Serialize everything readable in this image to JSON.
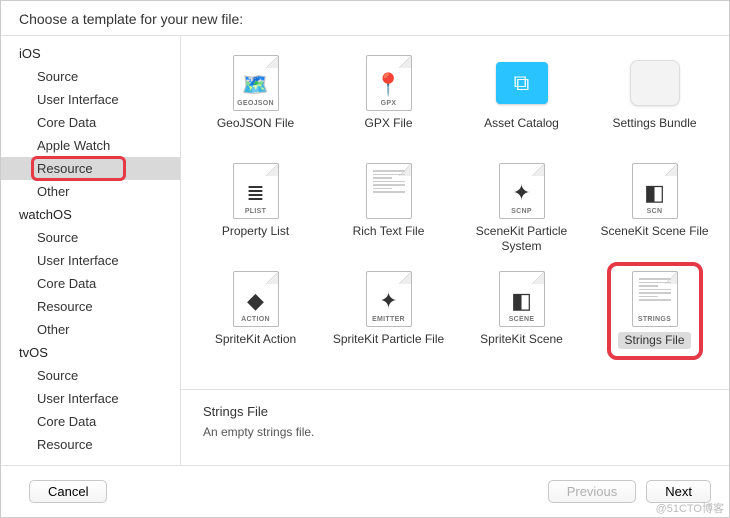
{
  "header": {
    "title": "Choose a template for your new file:"
  },
  "sidebar": {
    "platforms": [
      {
        "name": "iOS",
        "categories": [
          "Source",
          "User Interface",
          "Core Data",
          "Apple Watch",
          "Resource",
          "Other"
        ],
        "selected": "Resource"
      },
      {
        "name": "watchOS",
        "categories": [
          "Source",
          "User Interface",
          "Core Data",
          "Resource",
          "Other"
        ]
      },
      {
        "name": "tvOS",
        "categories": [
          "Source",
          "User Interface",
          "Core Data",
          "Resource"
        ]
      }
    ]
  },
  "templates": {
    "rows": [
      [
        {
          "label": "GeoJSON File",
          "tag": "GEOJSON",
          "glyph": "🗺️"
        },
        {
          "label": "GPX File",
          "tag": "GPX",
          "glyph": "📍"
        },
        {
          "label": "Asset Catalog",
          "type": "asset"
        },
        {
          "label": "Settings Bundle",
          "type": "bundle"
        }
      ],
      [
        {
          "label": "Property List",
          "tag": "PLIST",
          "glyph": "≣"
        },
        {
          "label": "Rich Text File",
          "tag": "",
          "glyph": "",
          "rtf": true
        },
        {
          "label": "SceneKit Particle System",
          "tag": "SCNP",
          "glyph": "✦"
        },
        {
          "label": "SceneKit Scene File",
          "tag": "SCN",
          "glyph": "◧"
        }
      ],
      [
        {
          "label": "SpriteKit Action",
          "tag": "ACTION",
          "glyph": "◆"
        },
        {
          "label": "SpriteKit Particle File",
          "tag": "EMITTER",
          "glyph": "✦"
        },
        {
          "label": "SpriteKit Scene",
          "tag": "SCENE",
          "glyph": "◧"
        },
        {
          "label": "Strings File",
          "tag": "STRINGS",
          "selected": true,
          "strings": true
        }
      ]
    ]
  },
  "description": {
    "title": "Strings File",
    "text": "An empty strings file."
  },
  "footer": {
    "cancel": "Cancel",
    "previous": "Previous",
    "next": "Next"
  },
  "watermark": "@51CTO博客"
}
